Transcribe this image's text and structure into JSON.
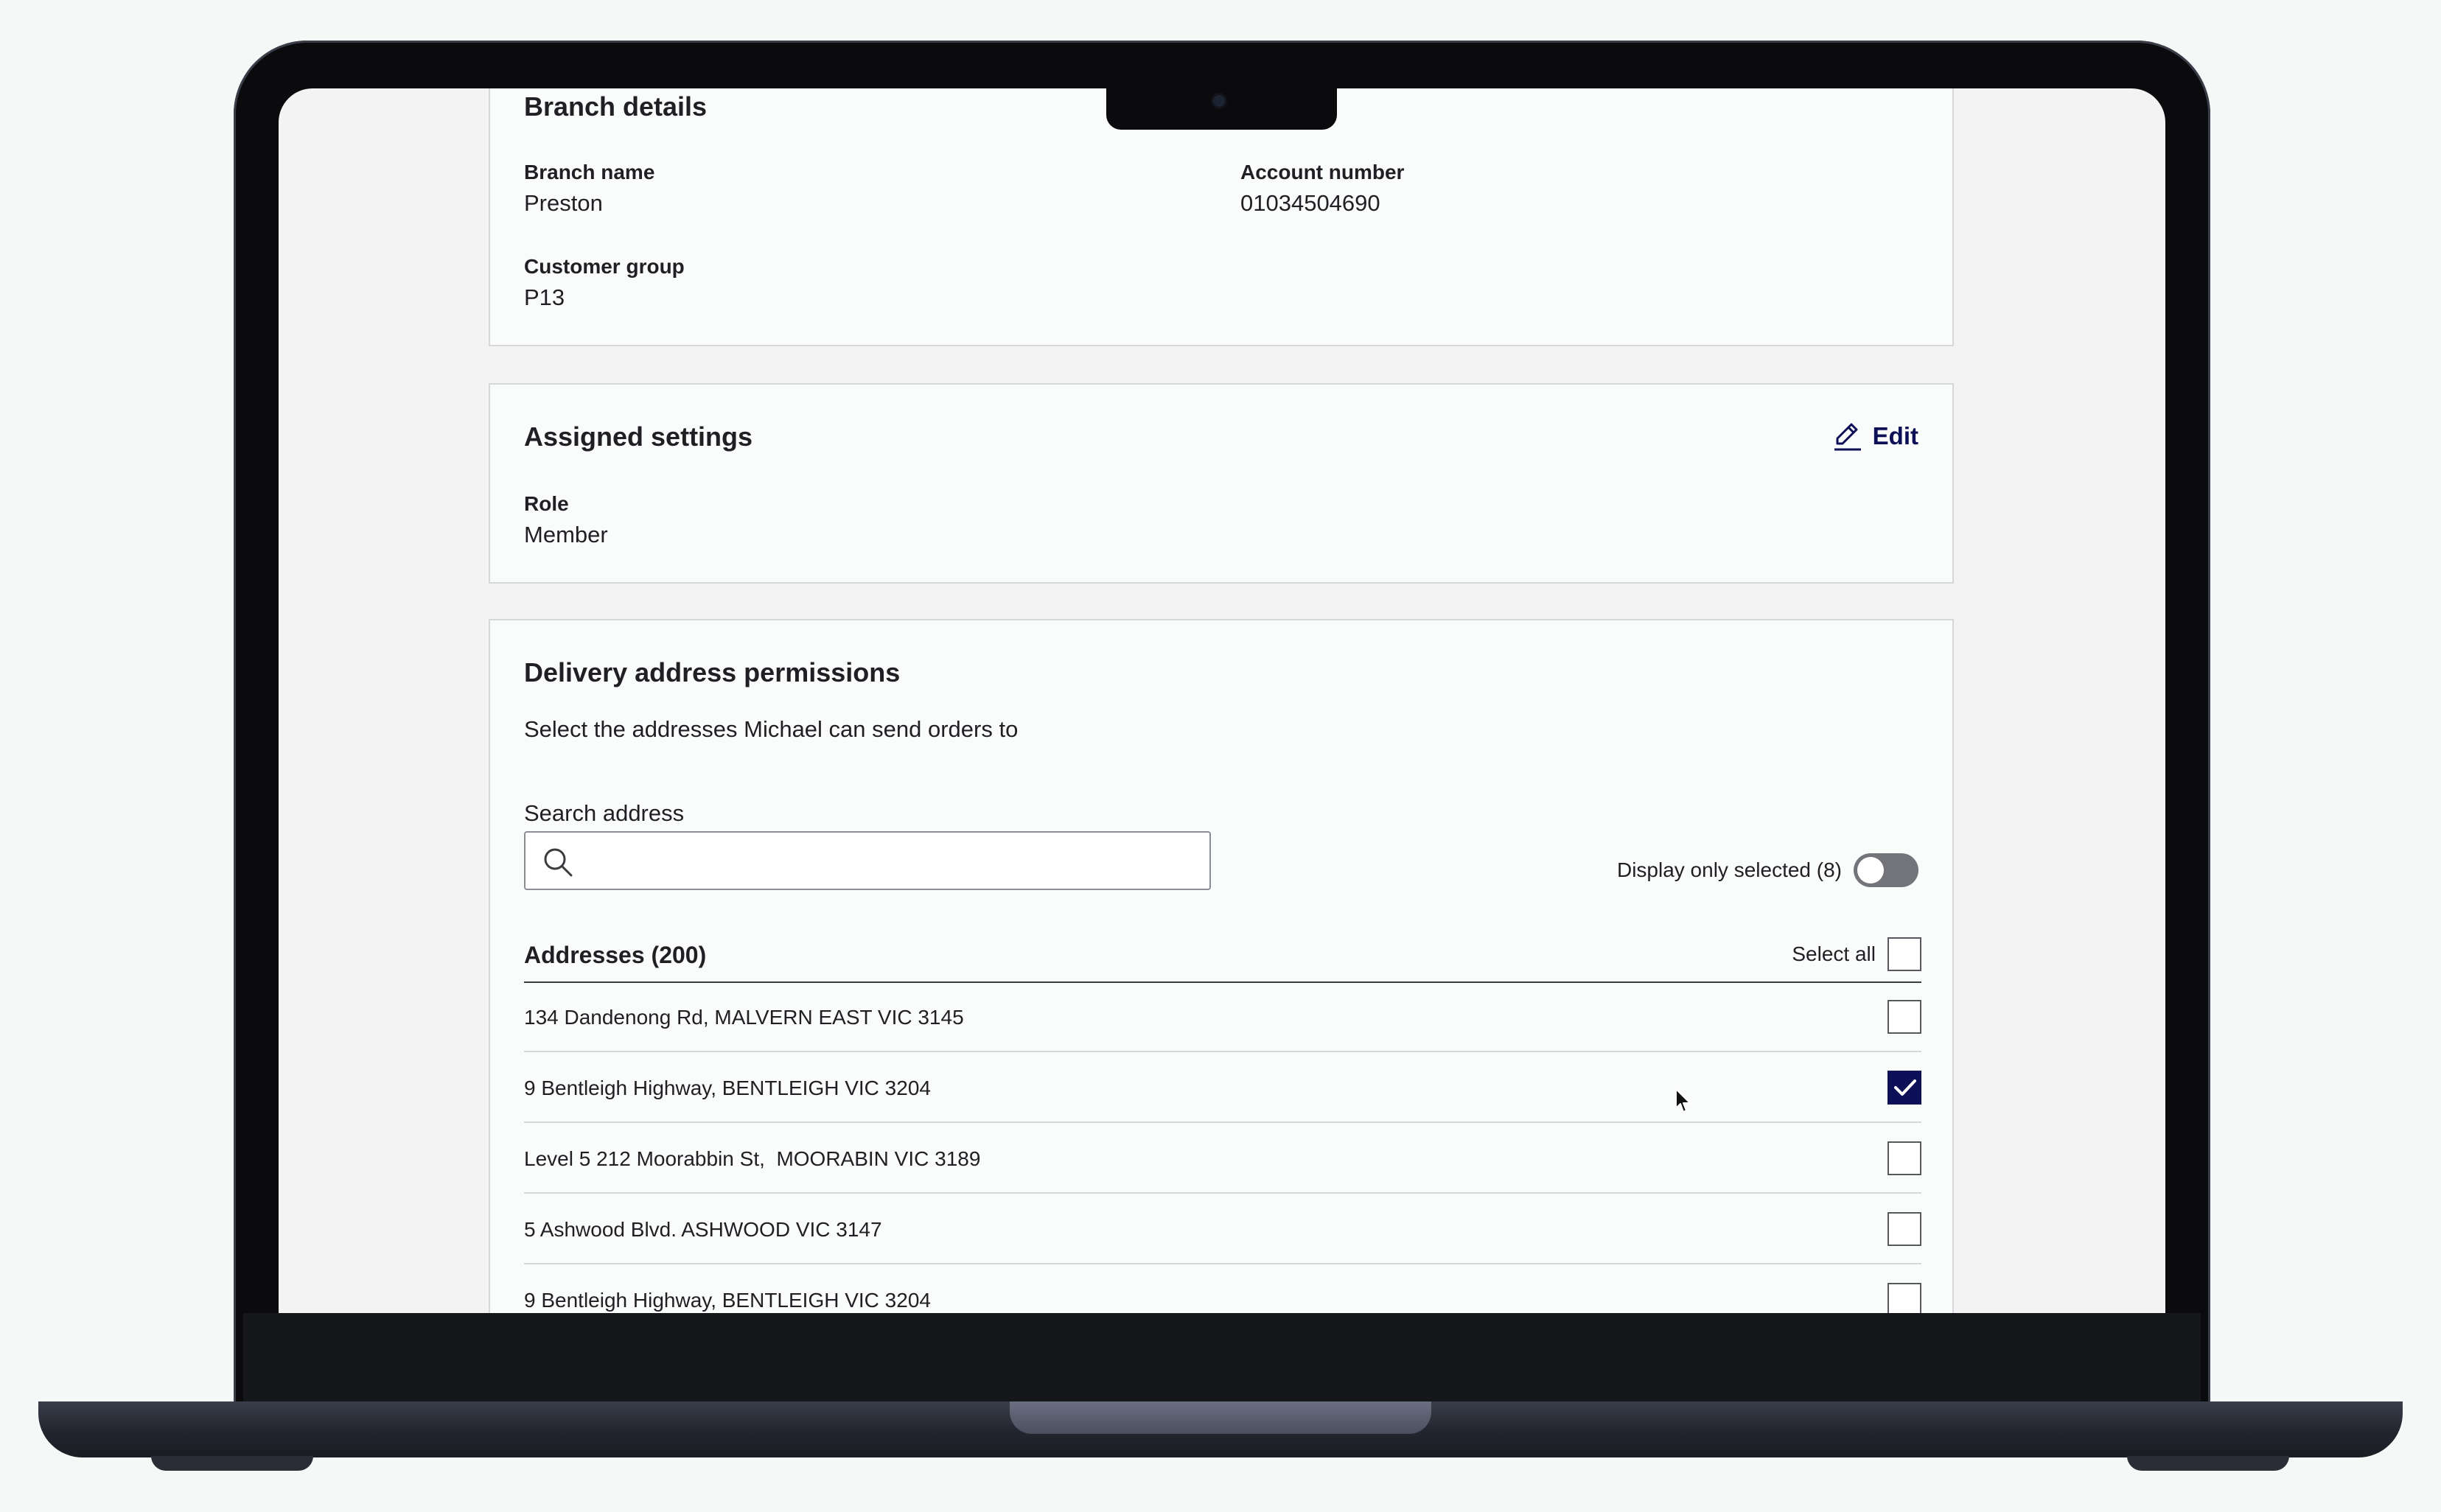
{
  "branch_details": {
    "title": "Branch details",
    "branch_name_label": "Branch name",
    "branch_name_value": "Preston",
    "account_number_label": "Account number",
    "account_number_value": "01034504690",
    "customer_group_label": "Customer group",
    "customer_group_value": "P13"
  },
  "assigned_settings": {
    "title": "Assigned settings",
    "edit_label": "Edit",
    "role_label": "Role",
    "role_value": "Member"
  },
  "delivery": {
    "title": "Delivery address permissions",
    "description": "Select the addresses Michael can send orders to",
    "search_label": "Search address",
    "search_value": "",
    "search_placeholder": "",
    "toggle_label": "Display only selected (8)",
    "toggle_on": false,
    "list_title": "Addresses (200)",
    "select_all_label": "Select all",
    "addresses": [
      {
        "text": "134 Dandenong Rd, MALVERN EAST VIC 3145",
        "checked": false
      },
      {
        "text": "9 Bentleigh Highway, BENTLEIGH VIC 3204",
        "checked": true
      },
      {
        "text": "Level 5 212 Moorabbin St,  MOORABIN VIC 3189",
        "checked": false
      },
      {
        "text": "5 Ashwood Blvd. ASHWOOD VIC 3147",
        "checked": false
      },
      {
        "text": "9 Bentleigh Highway, BENTLEIGH VIC 3204",
        "checked": false
      }
    ]
  },
  "colors": {
    "accent": "#0d1057",
    "border": "#d5d7da",
    "card_bg": "#fafbfb"
  }
}
